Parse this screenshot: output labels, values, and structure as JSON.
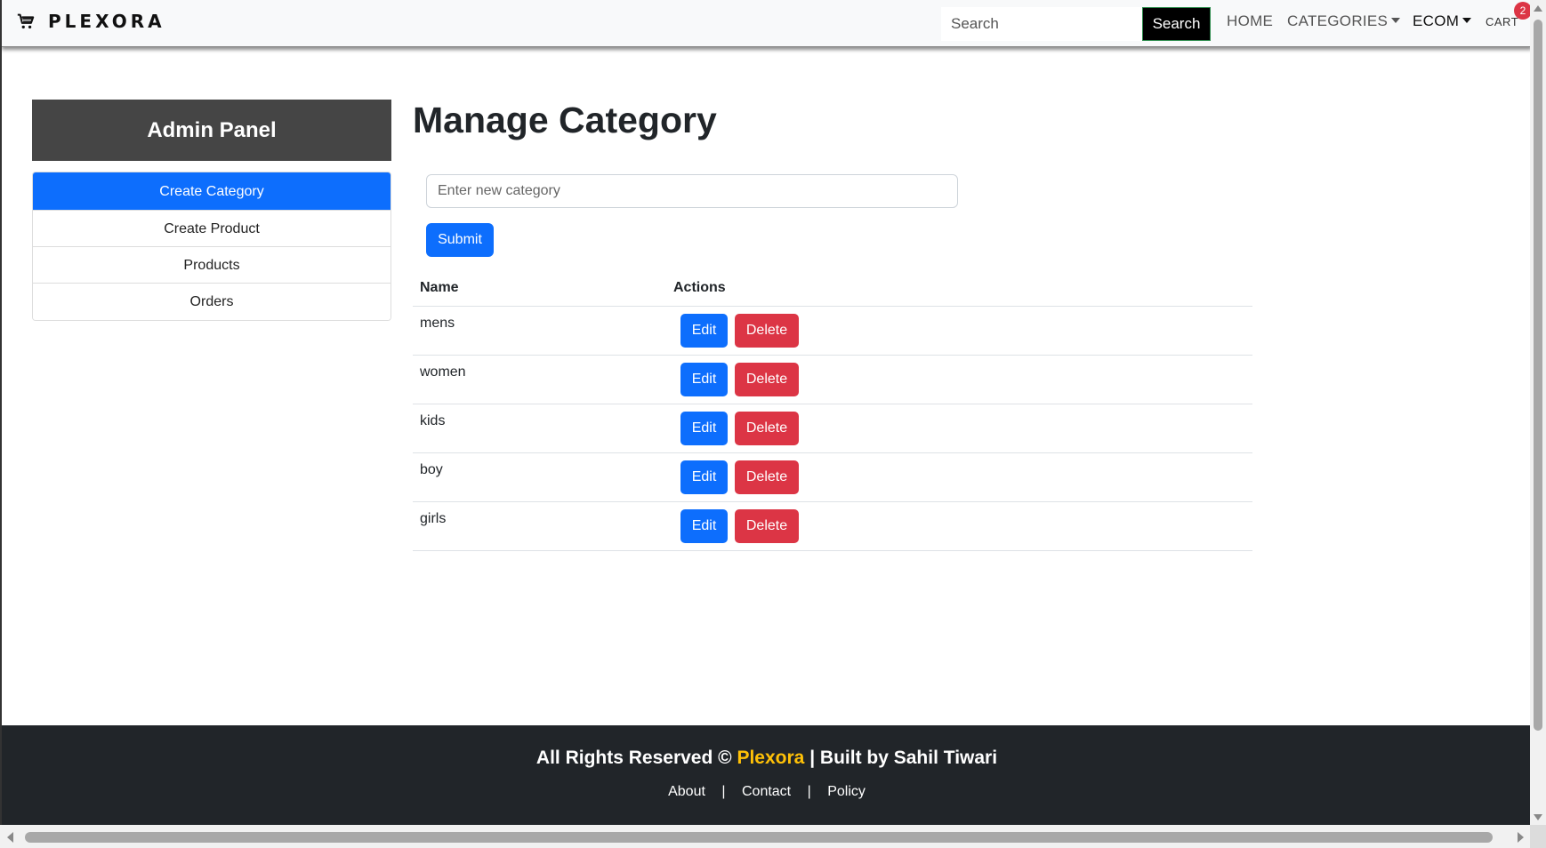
{
  "navbar": {
    "brand": "PLEXORA",
    "brand_icon": "shopping-cart-icon",
    "search_placeholder": "Search",
    "search_button": "Search",
    "links": {
      "home": "HOME",
      "categories": "CATEGORIES",
      "ecom": "ECOM",
      "cart": "CART"
    },
    "cart_count": "2"
  },
  "sidebar": {
    "title": "Admin Panel",
    "items": [
      {
        "label": "Create Category",
        "active": true
      },
      {
        "label": "Create Product",
        "active": false
      },
      {
        "label": "Products",
        "active": false
      },
      {
        "label": "Orders",
        "active": false
      }
    ]
  },
  "main": {
    "title": "Manage Category",
    "input_placeholder": "Enter new category",
    "submit_label": "Submit",
    "table": {
      "headers": {
        "name": "Name",
        "actions": "Actions"
      },
      "rows": [
        {
          "name": "mens",
          "edit": "Edit",
          "delete": "Delete"
        },
        {
          "name": "women",
          "edit": "Edit",
          "delete": "Delete"
        },
        {
          "name": "kids",
          "edit": "Edit",
          "delete": "Delete"
        },
        {
          "name": "boy",
          "edit": "Edit",
          "delete": "Delete"
        },
        {
          "name": "girls",
          "edit": "Edit",
          "delete": "Delete"
        }
      ]
    }
  },
  "footer": {
    "prefix": "All Rights Reserved ©",
    "brand": "Plexora",
    "suffix": "| Built by Sahil Tiwari",
    "links": [
      "About",
      "Contact",
      "Policy"
    ],
    "separator": "|"
  },
  "colors": {
    "primary": "#0d6efd",
    "danger": "#dc3545",
    "footer_bg": "#212529",
    "accent": "#ffc107",
    "admin_header_bg": "#454545"
  }
}
